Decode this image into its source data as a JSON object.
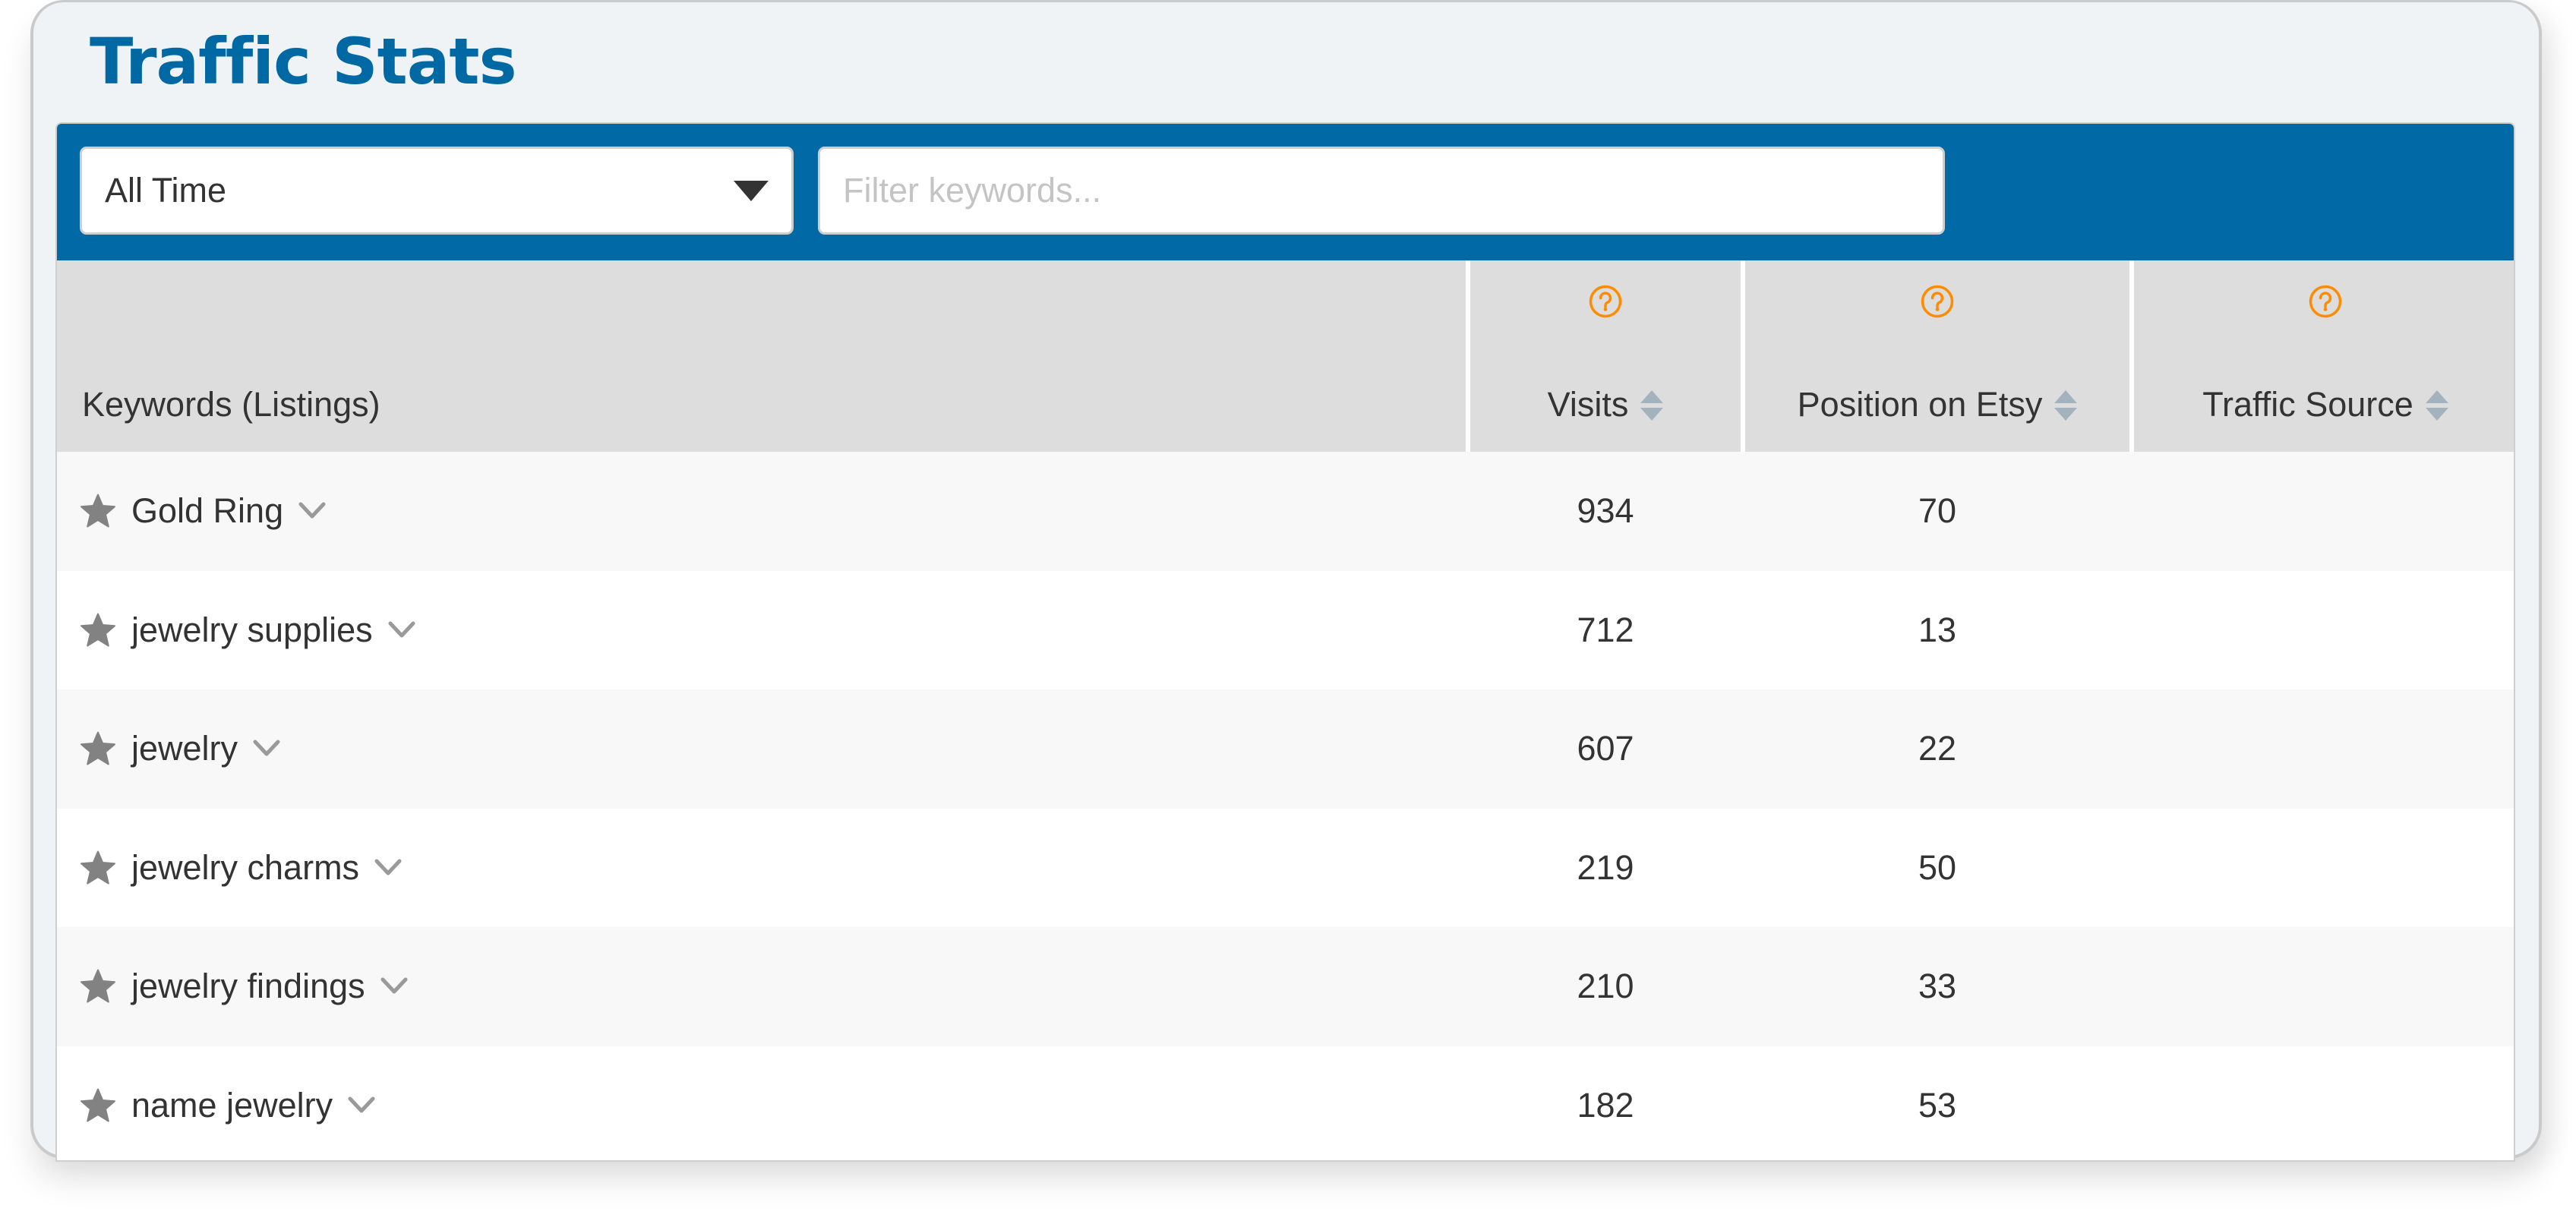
{
  "page": {
    "title": "Traffic Stats"
  },
  "toolbar": {
    "period_select": {
      "value": "All Time"
    },
    "filter": {
      "value": "",
      "placeholder": "Filter keywords..."
    }
  },
  "colors": {
    "brand_blue": "#0169a5",
    "title_blue": "#0069a3",
    "help_orange": "#ff8c00",
    "sort_gray": "#a3b3bd",
    "icon_gray": "#808080"
  },
  "table": {
    "columns": [
      {
        "key": "keyword",
        "label": "Keywords (Listings)",
        "help_icon": false,
        "sortable": false
      },
      {
        "key": "visits",
        "label": "Visits",
        "help_icon": true,
        "sortable": true
      },
      {
        "key": "position",
        "label": "Position on Etsy",
        "help_icon": true,
        "sortable": true
      },
      {
        "key": "traffic_source",
        "label": "Traffic Source",
        "help_icon": true,
        "sortable": true
      }
    ],
    "rows": [
      {
        "keyword": "Gold Ring",
        "visits": "934",
        "position": "70",
        "traffic_source": ""
      },
      {
        "keyword": "jewelry supplies",
        "visits": "712",
        "position": "13",
        "traffic_source": ""
      },
      {
        "keyword": "jewelry",
        "visits": "607",
        "position": "22",
        "traffic_source": ""
      },
      {
        "keyword": "jewelry charms",
        "visits": "219",
        "position": "50",
        "traffic_source": ""
      },
      {
        "keyword": "jewelry findings",
        "visits": "210",
        "position": "33",
        "traffic_source": ""
      },
      {
        "keyword": "name jewelry",
        "visits": "182",
        "position": "53",
        "traffic_source": ""
      }
    ]
  },
  "icons": {
    "star": "star-icon",
    "chevron": "chevron-down-icon",
    "help": "question-circle-icon",
    "sort": "sort-icon",
    "dropdown": "caret-down-icon"
  }
}
